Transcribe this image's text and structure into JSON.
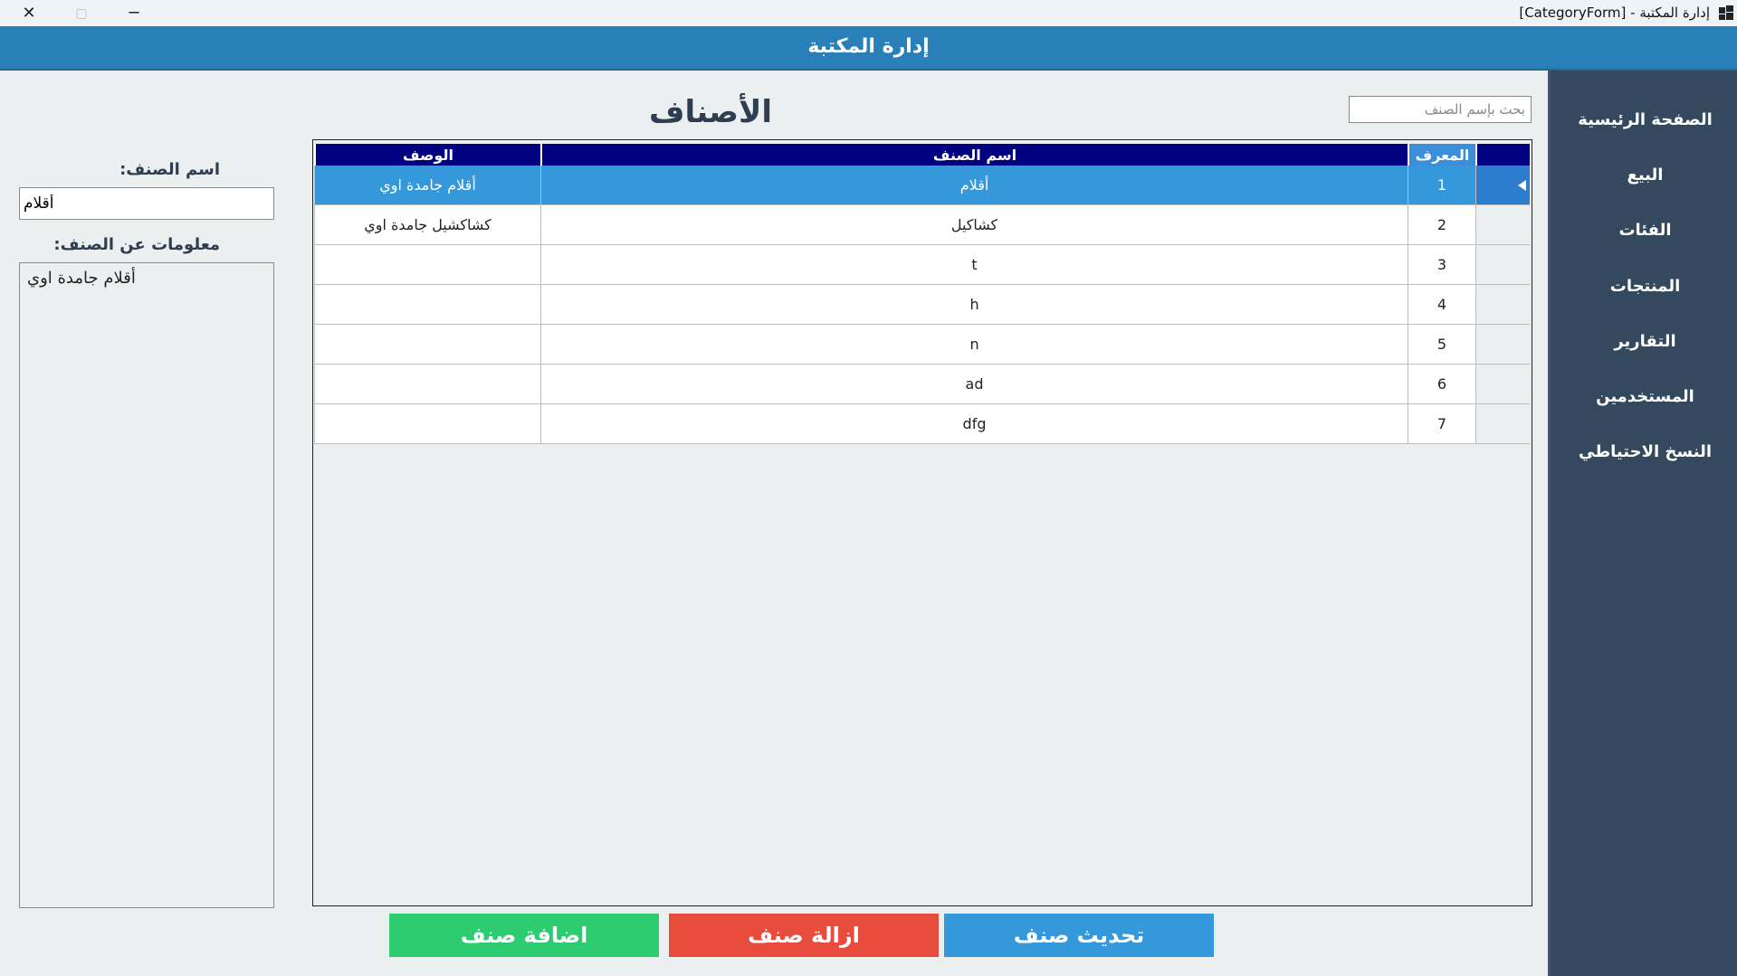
{
  "window": {
    "title": "إدارة المكتبة - [CategoryForm]",
    "controls": {
      "close": "✕",
      "restore": "▢",
      "minimize": "─"
    }
  },
  "header": {
    "app_name": "إدارة المكتبة"
  },
  "sidebar": {
    "items": [
      {
        "label": "الصفحة الرئيسية"
      },
      {
        "label": "البيع"
      },
      {
        "label": "الفئات"
      },
      {
        "label": "المنتجات"
      },
      {
        "label": "التقارير"
      },
      {
        "label": "المستخدمين"
      },
      {
        "label": "النسخ الاحتياطي"
      }
    ]
  },
  "main": {
    "title": "الأصناف",
    "search": {
      "placeholder": "بحث بإسم الصنف",
      "value": ""
    },
    "table": {
      "headers": {
        "id": "المعرف",
        "name": "اسم الصنف",
        "description": "الوصف"
      },
      "selected_row": 1,
      "rows": [
        {
          "id": "1",
          "name": "أقلام",
          "description": "أقلام جامدة اوي"
        },
        {
          "id": "2",
          "name": "كشاكيل",
          "description": "كشاكشيل جامدة اوي"
        },
        {
          "id": "3",
          "name": "t",
          "description": ""
        },
        {
          "id": "4",
          "name": "h",
          "description": ""
        },
        {
          "id": "5",
          "name": "n",
          "description": ""
        },
        {
          "id": "6",
          "name": "ad",
          "description": ""
        },
        {
          "id": "7",
          "name": "dfg",
          "description": ""
        }
      ]
    }
  },
  "form": {
    "name_label": "اسم الصنف:",
    "name_value": "أقلام",
    "info_label": "معلومات عن الصنف:",
    "info_value": "أقلام جامدة اوي"
  },
  "buttons": {
    "update": "تحديث صنف",
    "delete": "ازالة صنف",
    "add": "اضافة صنف"
  },
  "colors": {
    "header": "#2980B9",
    "sidebar": "#34495E",
    "table_header": "#000080",
    "selected_row": "#3498DB",
    "button_update": "#3498DB",
    "button_delete": "#E74C3C",
    "button_add": "#2ECC71"
  },
  "icons": {
    "app": "windows-forms-icon"
  }
}
